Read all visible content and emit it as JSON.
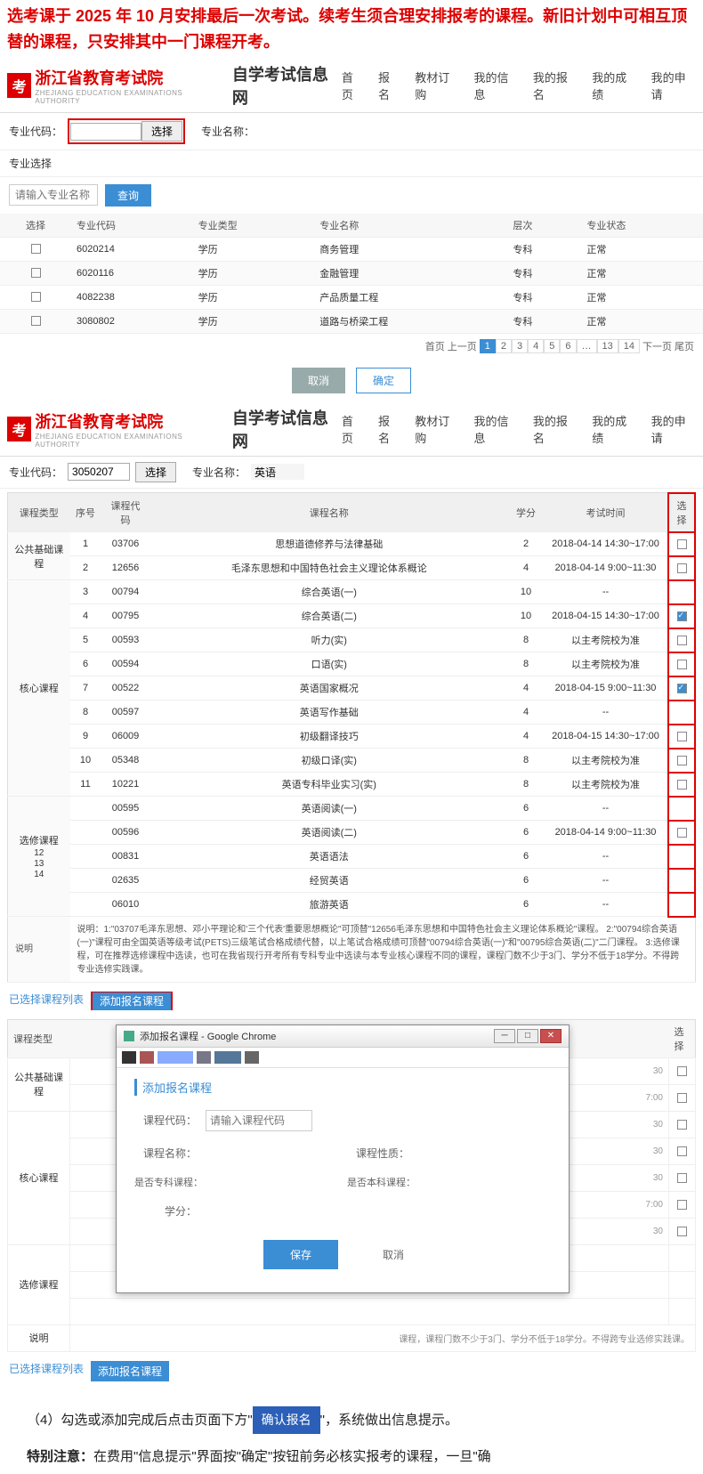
{
  "intro_text": "选考课于 2025 年 10 月安排最后一次考试。续考生须合理安排报考的课程。新旧计划中可相互顶替的课程，只安排其中一门课程开考。",
  "org": {
    "name": "浙江省教育考试院",
    "sub": "ZHEJIANG EDUCATION EXAMINATIONS AUTHORITY",
    "site": "自学考试信息网",
    "logo": "考"
  },
  "nav": [
    "首页",
    "报名",
    "教材订购",
    "我的信息",
    "我的报名",
    "我的成绩",
    "我的申请"
  ],
  "s1": {
    "filter": {
      "label": "专业代码：",
      "btn": "选择",
      "name_label": "专业名称："
    },
    "section": "专业选择",
    "search": {
      "placeholder": "请输入专业名称",
      "btn": "查询"
    },
    "thead": [
      "选择",
      "专业代码",
      "专业类型",
      "专业名称",
      "层次",
      "专业状态"
    ],
    "rows": [
      {
        "code": "6020214",
        "type": "学历",
        "name": "商务管理",
        "level": "专科",
        "status": "正常"
      },
      {
        "code": "6020116",
        "type": "学历",
        "name": "金融管理",
        "level": "专科",
        "status": "正常"
      },
      {
        "code": "4082238",
        "type": "学历",
        "name": "产品质量工程",
        "level": "专科",
        "status": "正常"
      },
      {
        "code": "3080802",
        "type": "学历",
        "name": "道路与桥梁工程",
        "level": "专科",
        "status": "正常"
      }
    ],
    "pager": {
      "first": "首页",
      "prev": "上一页",
      "pages": [
        "1",
        "2",
        "3",
        "4",
        "5",
        "6",
        "…",
        "13",
        "14"
      ],
      "next": "下一页",
      "last": "尾页"
    },
    "cancel": "取消",
    "ok": "确定"
  },
  "s2": {
    "filter": {
      "label": "专业代码：",
      "value": "3050207",
      "btn": "选择",
      "name_label": "专业名称：",
      "name_value": "英语"
    },
    "thead": [
      "课程类型",
      "序号",
      "课程代码",
      "课程名称",
      "学分",
      "考试时间",
      "选择"
    ],
    "groups": [
      {
        "cat": "公共基础课程",
        "rows": [
          {
            "n": "1",
            "code": "03706",
            "name": "思想道德修养与法律基础",
            "credit": "2",
            "time": "2018-04-14 14:30~17:00",
            "sel": false
          },
          {
            "n": "2",
            "code": "12656",
            "name": "毛泽东思想和中国特色社会主义理论体系概论",
            "credit": "4",
            "time": "2018-04-14 9:00~11:30",
            "sel": false
          }
        ]
      },
      {
        "cat": "核心课程",
        "rows": [
          {
            "n": "3",
            "code": "00794",
            "name": "综合英语(一)",
            "credit": "10",
            "time": "--",
            "sel": null
          },
          {
            "n": "4",
            "code": "00795",
            "name": "综合英语(二)",
            "credit": "10",
            "time": "2018-04-15 14:30~17:00",
            "sel": true
          },
          {
            "n": "5",
            "code": "00593",
            "name": "听力(实)",
            "credit": "8",
            "time": "以主考院校为准",
            "sel": false
          },
          {
            "n": "6",
            "code": "00594",
            "name": "口语(实)",
            "credit": "8",
            "time": "以主考院校为准",
            "sel": false
          },
          {
            "n": "7",
            "code": "00522",
            "name": "英语国家概况",
            "credit": "4",
            "time": "2018-04-15 9:00~11:30",
            "sel": true
          },
          {
            "n": "8",
            "code": "00597",
            "name": "英语写作基础",
            "credit": "4",
            "time": "--",
            "sel": null
          },
          {
            "n": "9",
            "code": "06009",
            "name": "初级翻译技巧",
            "credit": "4",
            "time": "2018-04-15 14:30~17:00",
            "sel": false
          },
          {
            "n": "10",
            "code": "05348",
            "name": "初级口译(实)",
            "credit": "8",
            "time": "以主考院校为准",
            "sel": false
          },
          {
            "n": "11",
            "code": "10221",
            "name": "英语专科毕业实习(实)",
            "credit": "8",
            "time": "以主考院校为准",
            "sel": false
          }
        ]
      },
      {
        "cat": "选修课程",
        "catnote": "12\n13\n14",
        "rows": [
          {
            "n": "",
            "code": "00595",
            "name": "英语阅读(一)",
            "credit": "6",
            "time": "--",
            "sel": null
          },
          {
            "n": "",
            "code": "00596",
            "name": "英语阅读(二)",
            "credit": "6",
            "time": "2018-04-14 9:00~11:30",
            "sel": false
          },
          {
            "n": "",
            "code": "00831",
            "name": "英语语法",
            "credit": "6",
            "time": "--",
            "sel": null
          },
          {
            "n": "",
            "code": "02635",
            "name": "经贸英语",
            "credit": "6",
            "time": "--",
            "sel": null
          },
          {
            "n": "",
            "code": "06010",
            "name": "旅游英语",
            "credit": "6",
            "time": "--",
            "sel": null
          }
        ]
      }
    ],
    "note_label": "说明",
    "note": "说明：1:\"03707毛泽东思想、邓小平理论和'三个代表'重要思想概论\"可顶替\"12656毛泽东思想和中国特色社会主义理论体系概论\"课程。\n2:\"00794综合英语(一)\"课程可由全国英语等级考试(PETS)三级笔试合格成绩代替，以上笔试合格成绩可顶替\"00794综合英语(一)\"和\"00795综合英语(二)\"二门课程。\n3:选修课程，可在推荐选修课程中选读，也可在我省现行开考所有专科专业中选读与本专业核心课程不同的课程，课程门数不少于3门、学分不低于18学分。不得跨专业选修实践课。",
    "tabs": {
      "list": "已选择课程列表",
      "add": "添加报名课程"
    }
  },
  "s3": {
    "thead": [
      "课程类型",
      "",
      "",
      "",
      "",
      "",
      "选择"
    ],
    "cats": [
      "公共基础课程",
      "核心课程",
      "选修课程",
      "说明"
    ],
    "times": [
      "30",
      "7:00",
      "30",
      "30",
      "30",
      "7:00",
      "30"
    ],
    "tabs": {
      "list": "已选择课程列表",
      "add": "添加报名课程"
    },
    "note_text": "课程，课程门数不少于3门、学分不低于18学分。不得跨专业选修实践课。",
    "modal": {
      "title": "添加报名课程 - Google Chrome",
      "heading": "添加报名课程",
      "fields": {
        "code_label": "课程代码：",
        "code_placeholder": "请输入课程代码",
        "name_label": "课程名称：",
        "nature_label": "课程性质：",
        "zk_label": "是否专科课程：",
        "bk_label": "是否本科课程：",
        "credit_label": "学分："
      },
      "save": "保存",
      "cancel": "取消"
    }
  },
  "footer": {
    "p1_a": "（4）勾选或添加完成后点击页面下方\"",
    "confirm": "确认报名",
    "p1_b": "\"，系统做出信息提示。",
    "p2_label": "特别注意：",
    "p2": "在费用\"信息提示\"界面按\"确定\"按钮前务必核实报考的课程，一旦\"确"
  }
}
